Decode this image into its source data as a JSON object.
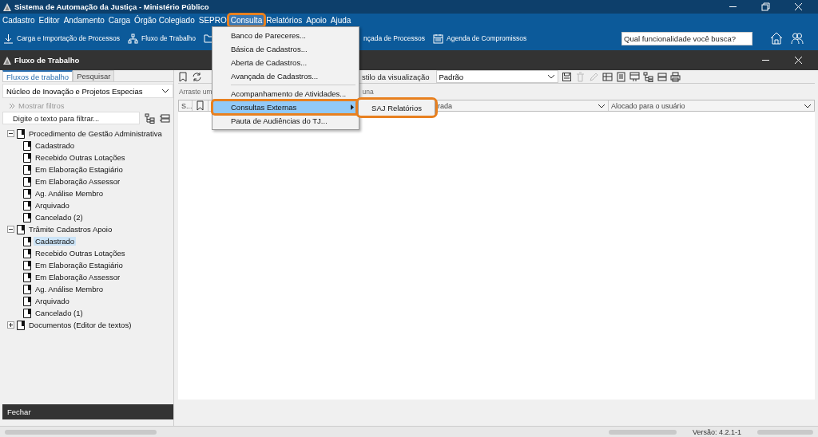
{
  "window": {
    "title": "Sistema de Automação da Justiça - Ministério Público"
  },
  "menu_bar": [
    {
      "label": "Cadastro",
      "selected": false,
      "highlighted": false
    },
    {
      "label": "Editor",
      "selected": false,
      "highlighted": false
    },
    {
      "label": "Andamento",
      "selected": false,
      "highlighted": false
    },
    {
      "label": "Carga",
      "selected": false,
      "highlighted": false
    },
    {
      "label": "Órgão Colegiado",
      "selected": false,
      "highlighted": false
    },
    {
      "label": "SEPRO",
      "selected": false,
      "highlighted": false
    },
    {
      "label": "Consulta",
      "selected": true,
      "highlighted": true
    },
    {
      "label": "Relatórios",
      "selected": false,
      "highlighted": false
    },
    {
      "label": "Apoio",
      "selected": false,
      "highlighted": false
    },
    {
      "label": "Ajuda",
      "selected": false,
      "highlighted": false
    }
  ],
  "toolbar": [
    {
      "kind": "download",
      "label": "Carga e Importação de Processos"
    },
    {
      "kind": "workflow",
      "label": "Fluxo de Trabalho"
    },
    {
      "kind": "folder"
    },
    {
      "kind": "text",
      "label": "nçada de Processos"
    },
    {
      "kind": "calendar",
      "label": "Agenda de Compromissos"
    }
  ],
  "search": {
    "placeholder": "Qual funcionalidade você busca?"
  },
  "panel": {
    "title": "Fluxo de Trabalho"
  },
  "left": {
    "tabs": [
      {
        "label": "Fluxos de trabalho",
        "selected": true
      },
      {
        "label": "Pesquisar",
        "selected": false
      }
    ],
    "unit_select": {
      "value": "Núcleo de Inovação e Projetos Especias"
    },
    "show_filters": "Mostrar filtros",
    "filter": {
      "placeholder": "Digite o texto para filtrar..."
    },
    "tree": [
      {
        "label": "Procedimento de Gestão Administrativa",
        "expanded": true,
        "selected": false,
        "children": [
          {
            "label": "Cadastrado",
            "selected": false
          },
          {
            "label": "Recebido Outras Lotações",
            "selected": false
          },
          {
            "label": "Em Elaboração Estagiário",
            "selected": false
          },
          {
            "label": "Em Elaboração Assessor",
            "selected": false
          },
          {
            "label": "Ag. Análise Membro",
            "selected": false
          },
          {
            "label": "Arquivado",
            "selected": false
          },
          {
            "label": "Cancelado (2)",
            "selected": false
          }
        ]
      },
      {
        "label": "Trâmite Cadastros Apoio",
        "expanded": true,
        "selected": false,
        "children": [
          {
            "label": "Cadastrado",
            "selected": true
          },
          {
            "label": "Recebido Outras Lotações",
            "selected": false
          },
          {
            "label": "Em Elaboração Estagiário",
            "selected": false
          },
          {
            "label": "Em Elaboração Assessor",
            "selected": false
          },
          {
            "label": "Ag. Análise Membro",
            "selected": false
          },
          {
            "label": "Arquivado",
            "selected": false
          },
          {
            "label": "Cancelado (1)",
            "selected": false
          }
        ]
      },
      {
        "label": "Documentos (Editor de textos)",
        "expanded": false,
        "selected": false
      }
    ],
    "close_button": "Fechar"
  },
  "right": {
    "style_label": "stilo da visualização",
    "style_select": {
      "value": "Padrão"
    },
    "group_bar": {
      "text_1": "Arraste um",
      "text_2": "una"
    },
    "columns": [
      {
        "label": "S..."
      },
      {
        "label": "rada"
      },
      {
        "label": "Alocado para o usuário"
      }
    ]
  },
  "dropdown_menu": [
    {
      "kind": "item",
      "label": "Banco de Pareceres...",
      "selected": false,
      "highlighted": false,
      "submenu": false
    },
    {
      "kind": "item",
      "label": "Básica de Cadastros...",
      "selected": false,
      "highlighted": false,
      "submenu": false
    },
    {
      "kind": "item",
      "label": "Aberta de Cadastros...",
      "selected": false,
      "highlighted": false,
      "submenu": false
    },
    {
      "kind": "item",
      "label": "Avançada de Cadastros...",
      "selected": false,
      "highlighted": false,
      "submenu": false
    },
    {
      "kind": "separator"
    },
    {
      "kind": "item",
      "label": "Acompanhamento de Atividades...",
      "selected": false,
      "highlighted": false,
      "submenu": false
    },
    {
      "kind": "item",
      "label": "Consultas Externas",
      "selected": true,
      "highlighted": true,
      "submenu": true
    },
    {
      "kind": "item",
      "label": "Pauta de Audiências do TJ...",
      "selected": false,
      "highlighted": false,
      "submenu": false
    }
  ],
  "submenu": [
    {
      "label": "SAJ Relatórios",
      "highlighted": true
    }
  ],
  "status_bar": {
    "version": "Versão: 4.2.1-1"
  }
}
